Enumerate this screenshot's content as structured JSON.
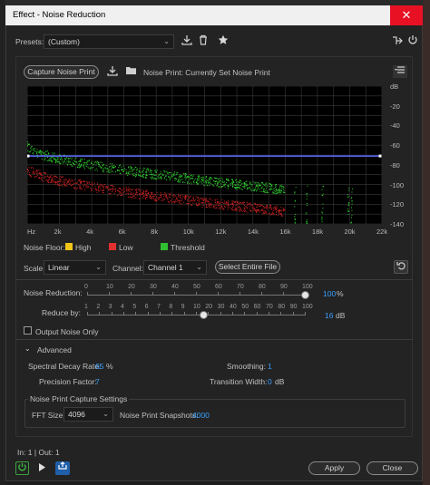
{
  "window": {
    "title": "Effect - Noise Reduction",
    "close_glyph": "✕"
  },
  "presets": {
    "label": "Presets:",
    "value": "(Custom)",
    "icons": [
      "save-preset-icon",
      "delete-preset-icon",
      "favorite-star-icon"
    ]
  },
  "noise_print": {
    "capture_label": "Capture Noise Print",
    "status": "Noise Print:  Currently Set Noise Print"
  },
  "graph": {
    "db_ticks": [
      "dB",
      "-20",
      "-40",
      "-60",
      "-80",
      "-100",
      "-120",
      "-140"
    ],
    "hz_ticks": [
      "Hz",
      "2k",
      "4k",
      "6k",
      "8k",
      "10k",
      "12k",
      "14k",
      "16k",
      "18k",
      "20k",
      "22k"
    ],
    "colors": {
      "threshold_line": "#5b6cff",
      "noise_green": "#2fd12f",
      "noise_red": "#d12222"
    }
  },
  "legend": {
    "label": "Noise Floor:",
    "items": [
      {
        "label": "High",
        "color": "#f0c419"
      },
      {
        "label": "Low",
        "color": "#e03030"
      },
      {
        "label": "Threshold",
        "color": "#2fbf2f"
      }
    ]
  },
  "scale": {
    "label": "Scale:",
    "value": "Linear"
  },
  "channel": {
    "label": "Channel:",
    "value": "Channel 1"
  },
  "select_entire_file": "Select Entire File",
  "noise_reduction": {
    "label": "Noise Reduction:",
    "ticks": [
      "0",
      "10",
      "20",
      "30",
      "40",
      "50",
      "60",
      "70",
      "80",
      "90",
      "100"
    ],
    "value": "100",
    "unit": "%",
    "level_percent": 100
  },
  "reduce_by": {
    "label": "Reduce by:",
    "ticks": [
      "1",
      "2",
      "3",
      "4",
      "5",
      "6",
      "7",
      "8",
      "9",
      "10",
      "20",
      "30",
      "40",
      "50",
      "60",
      "70",
      "80",
      "90",
      "100"
    ],
    "value": "16",
    "unit": "dB",
    "level_db": 16
  },
  "output_noise_only": {
    "label": "Output Noise Only",
    "checked": false
  },
  "advanced": {
    "label": "Advanced",
    "spectral_decay_label": "Spectral Decay Rate:",
    "spectral_decay_value": "65",
    "spectral_decay_unit": "%",
    "smoothing_label": "Smoothing:",
    "smoothing_value": "1",
    "precision_label": "Precision Factor:",
    "precision_value": "7",
    "transition_label": "Transition Width:",
    "transition_value": "0",
    "transition_unit": "dB"
  },
  "capture_settings": {
    "title": "Noise Print Capture Settings",
    "fft_label": "FFT Size:",
    "fft_value": "4096",
    "snapshots_label": "Noise Print Snapshots:",
    "snapshots_value": "4000"
  },
  "io": "In: 1 | Out: 1",
  "footer": {
    "apply": "Apply",
    "close": "Close"
  }
}
